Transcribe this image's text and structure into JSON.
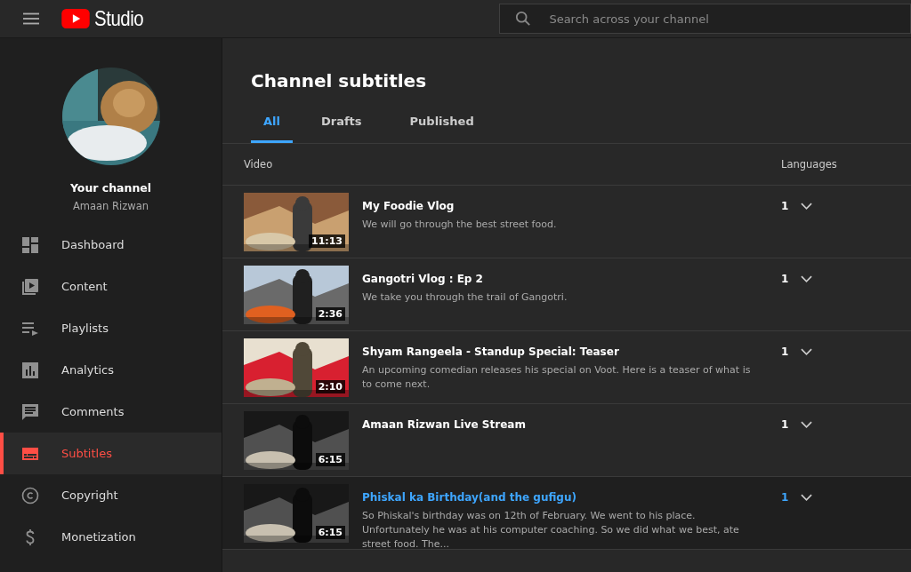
{
  "header": {
    "logo_text": "Studio",
    "search": {
      "placeholder": "Search across your channel"
    }
  },
  "sidebar": {
    "channel_label": "Your channel",
    "channel_name": "Amaan Rizwan",
    "items": [
      {
        "label": "Dashboard",
        "selected": false
      },
      {
        "label": "Content",
        "selected": false
      },
      {
        "label": "Playlists",
        "selected": false
      },
      {
        "label": "Analytics",
        "selected": false
      },
      {
        "label": "Comments",
        "selected": false
      },
      {
        "label": "Subtitles",
        "selected": true
      },
      {
        "label": "Copyright",
        "selected": false
      },
      {
        "label": "Monetization",
        "selected": false
      }
    ]
  },
  "page": {
    "title": "Channel subtitles",
    "tabs": [
      {
        "label": "All",
        "selected": true
      },
      {
        "label": "Drafts",
        "selected": false
      },
      {
        "label": "Published",
        "selected": false
      }
    ],
    "table": {
      "columns": [
        "Video",
        "Languages"
      ],
      "rows": [
        {
          "title": "My Foodie Vlog",
          "description": "We will go through the best street food.",
          "duration": "11:13",
          "languages": "1",
          "highlighted": false
        },
        {
          "title": "Gangotri Vlog : Ep 2",
          "description": "We take you through the trail of Gangotri.",
          "duration": "2:36",
          "languages": "1",
          "highlighted": false
        },
        {
          "title": "Shyam Rangeela - Standup Special: Teaser",
          "description": "An upcoming comedian releases his special on Voot. Here is a teaser of what is to come next.",
          "duration": "2:10",
          "languages": "1",
          "highlighted": false
        },
        {
          "title": "Amaan Rizwan Live Stream",
          "duration": "6:15",
          "languages": "1",
          "highlighted": false
        },
        {
          "title": "Phiskal ka Birthday(and the gufigu)",
          "description": "So Phiskal's birthday was on 12th of February. We went to his place. Unfortunately he was at his computer coaching. So we did what we best, ate street food. The...",
          "duration": "6:15",
          "languages": "1",
          "highlighted": true
        }
      ]
    }
  }
}
